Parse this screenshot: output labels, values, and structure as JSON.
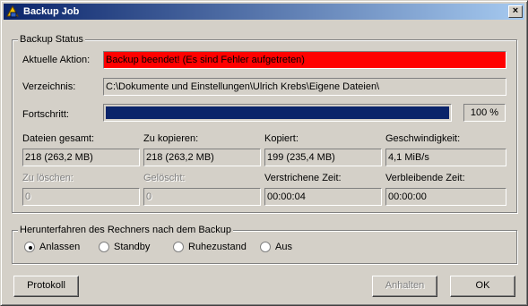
{
  "window": {
    "title": "Backup Job",
    "close_label": "×"
  },
  "status_group": {
    "title": "Backup Status",
    "current_action_label": "Aktuelle Aktion:",
    "current_action_value": "Backup beendet! (Es sind Fehler aufgetreten)",
    "directory_label": "Verzeichnis:",
    "directory_value": "C:\\Dokumente und Einstellungen\\Ulrich Krebs\\Eigene Dateien\\",
    "progress_label": "Fortschritt:",
    "progress_percent": 100,
    "progress_text": "100 %",
    "stats": [
      {
        "label": "Dateien gesamt:",
        "value": "218 (263,2 MB)",
        "disabled": false
      },
      {
        "label": "Zu kopieren:",
        "value": "218 (263,2 MB)",
        "disabled": false
      },
      {
        "label": "Kopiert:",
        "value": "199 (235,4 MB)",
        "disabled": false
      },
      {
        "label": "Geschwindigkeit:",
        "value": "4,1 MiB/s",
        "disabled": false
      },
      {
        "label": "Zu löschen:",
        "value": "0",
        "disabled": true
      },
      {
        "label": "Gelöscht:",
        "value": "0",
        "disabled": true
      },
      {
        "label": "Verstrichene Zeit:",
        "value": "00:00:04",
        "disabled": false
      },
      {
        "label": "Verbleibende Zeit:",
        "value": "00:00:00",
        "disabled": false
      }
    ]
  },
  "shutdown_group": {
    "title": "Herunterfahren des Rechners nach dem Backup",
    "options": [
      "Anlassen",
      "Standby",
      "Ruhezustand",
      "Aus"
    ],
    "selected": "Anlassen"
  },
  "buttons": {
    "log": "Protokoll",
    "stop": "Anhalten",
    "ok": "OK"
  },
  "colors": {
    "error_bg": "#ff0000",
    "progress_fill": "#0a246a",
    "title_start": "#0a246a",
    "title_end": "#a6caf0"
  }
}
